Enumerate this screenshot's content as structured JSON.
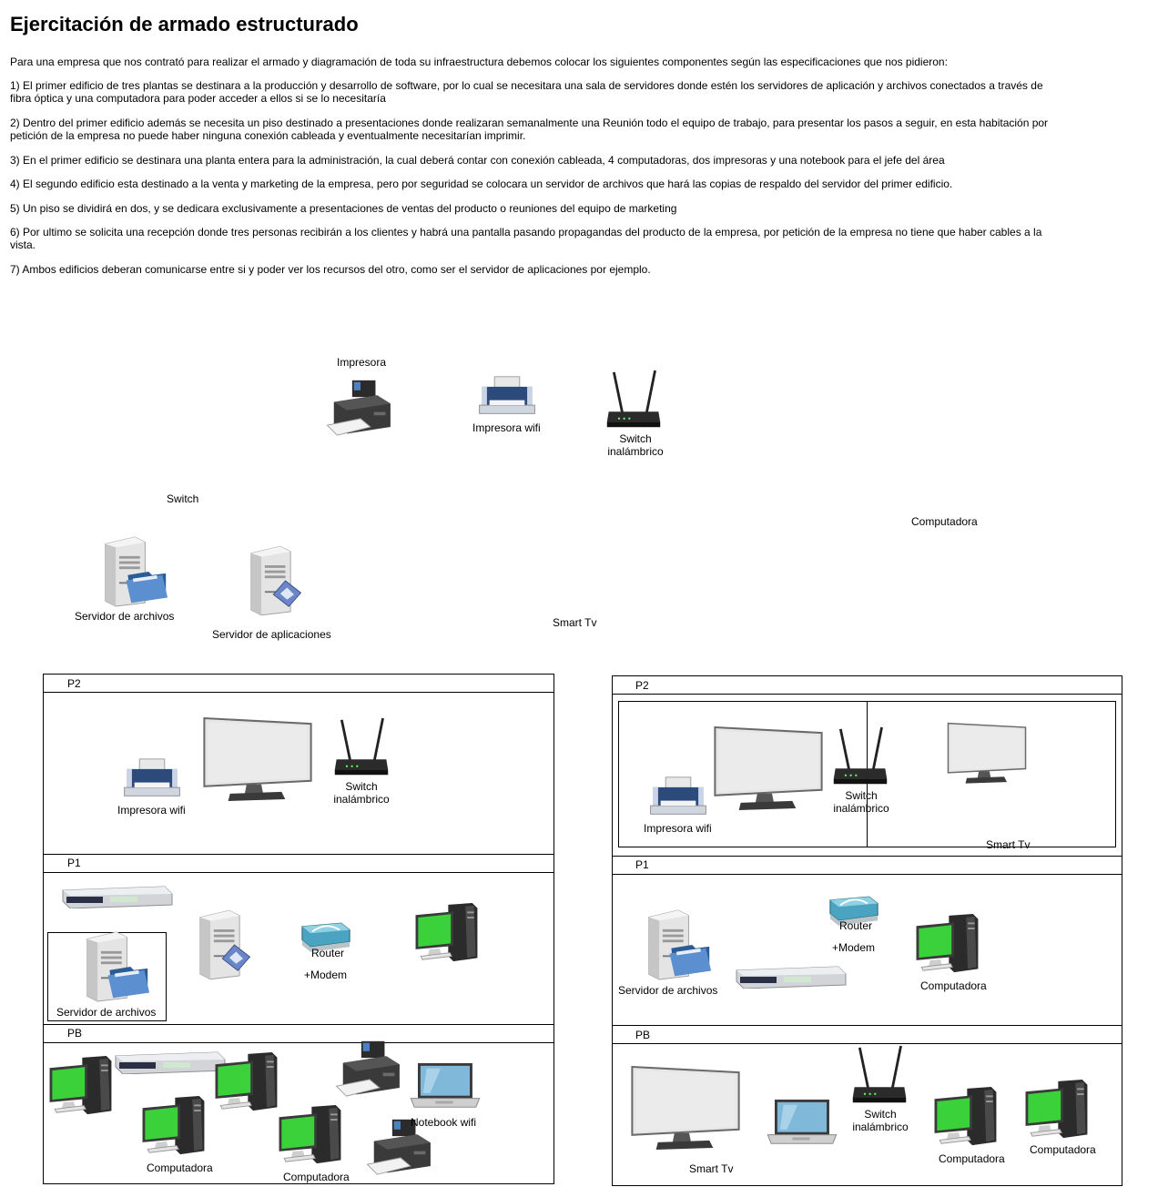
{
  "title": "Ejercitación de armado estructurado",
  "intro": "Para una empresa que  nos contrató para realizar el armado y diagramación de toda su infraestructura debemos colocar los siguientes componentes según las especificaciones que nos pidieron:",
  "requirements": [
    "1) El primer edificio de tres plantas se destinara a la producción y desarrollo de software, por lo cual se necesitara una sala de servidores donde estén los servidores de aplicación y archivos conectados a través de fibra óptica y una computadora para poder acceder a ellos si se lo necesitaría",
    "2) Dentro del primer edificio además se necesita un piso destinado a presentaciones donde realizaran semanalmente una Reunión todo el equipo de trabajo, para presentar los pasos a seguir, en esta habitación por petición de la empresa no puede haber ninguna conexión cableada y eventualmente necesitarían imprimir.",
    "3) En el primer edificio se destinara una planta entera para la administración, la cual deberá contar con conexión cableada, 4 computadoras, dos impresoras y una notebook para el jefe del área",
    "4) El segundo edificio esta destinado a la venta y marketing de la empresa, pero por seguridad se colocara un servidor de archivos que hará las copias de respaldo del servidor del primer edificio.",
    "5) Un piso se dividirá en dos, y se dedicara exclusivamente a presentaciones de ventas del producto o reuniones del equipo de marketing",
    "6) Por ultimo se solicita una recepción donde tres personas recibirán a los clientes y habrá una pantalla pasando propagandas del producto de la empresa, por petición de la empresa no tiene que haber cables a la vista.",
    "7) Ambos edificios deberan comunicarse entre si y poder ver los recursos del otro, como ser el servidor de aplicaciones por ejemplo."
  ],
  "palette": {
    "impresora": "Impresora",
    "impresora_wifi": "Impresora wifi",
    "switch_inalambrico": "Switch\ninalámbrico",
    "switch": "Switch",
    "computadora": "Computadora",
    "servidor_archivos": "Servidor de archivos",
    "servidor_aplicaciones": "Servidor de aplicaciones",
    "smart_tv": "Smart Tv"
  },
  "building1": {
    "floors": [
      "P2",
      "P1",
      "PB"
    ],
    "p2": {
      "impresora_wifi": "Impresora wifi",
      "switch_inalambrico": "Switch\ninalámbrico"
    },
    "p1": {
      "servidor_archivos": "Servidor de archivos",
      "router": "Router",
      "modem": "+Modem"
    },
    "pb": {
      "computadora_1": "Computadora",
      "computadora_2": "Computadora",
      "notebook": "Notebook wifi"
    }
  },
  "building2": {
    "floors": [
      "P2",
      "P1",
      "PB"
    ],
    "p2": {
      "impresora_wifi": "Impresora wifi",
      "switch_inalambrico": "Switch\ninalámbrico",
      "smart_tv": "Smart Tv"
    },
    "p1": {
      "servidor_archivos": "Servidor de archivos",
      "router": "Router",
      "modem": "+Modem",
      "computadora": "Computadora"
    },
    "pb": {
      "smart_tv": "Smart Tv",
      "switch_inalambrico": "Switch\ninalámbrico",
      "computadora_1": "Computadora",
      "computadora_2": "Computadora"
    }
  },
  "colors": {
    "screen_green": "#3ad13a",
    "tower_gray": "#d9d9d9",
    "printer_navy": "#2c4a7a",
    "router_teal": "#2a8aa0"
  }
}
